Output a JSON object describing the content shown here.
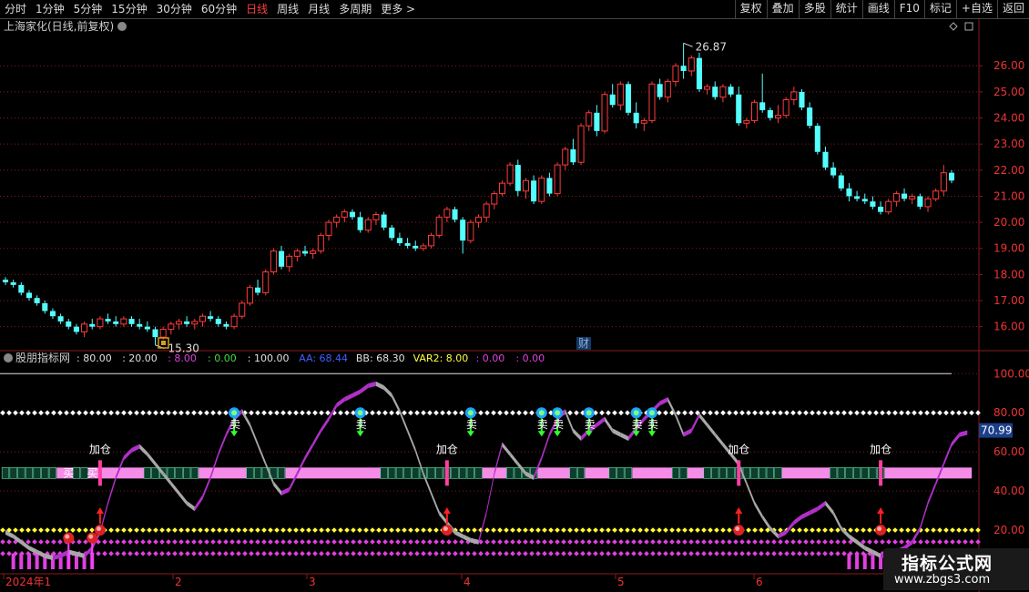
{
  "toolbar": {
    "left": [
      {
        "label": "分时",
        "active": false
      },
      {
        "label": "1分钟",
        "active": false
      },
      {
        "label": "5分钟",
        "active": false
      },
      {
        "label": "15分钟",
        "active": false
      },
      {
        "label": "30分钟",
        "active": false
      },
      {
        "label": "60分钟",
        "active": false
      },
      {
        "label": "日线",
        "active": true
      },
      {
        "label": "周线",
        "active": false
      },
      {
        "label": "月线",
        "active": false
      },
      {
        "label": "多周期",
        "active": false
      },
      {
        "label": "更多 >",
        "active": false
      }
    ],
    "right": [
      "复权",
      "叠加",
      "多股",
      "统计",
      "画线",
      "F10",
      "标记",
      "+自选",
      "返回"
    ]
  },
  "main_panel": {
    "title": "上海家化(日线,前复权)",
    "high_label": "26.87",
    "low_label": "15.30",
    "fin_marker": "财"
  },
  "indicator_panel": {
    "title": "股朋指标网",
    "values": [
      {
        "text": ": 80.00",
        "color": "#e0e0e0"
      },
      {
        "text": ": 20.00",
        "color": "#e0e0e0"
      },
      {
        "text": ": 8.00",
        "color": "#e040e0"
      },
      {
        "text": ": 0.00",
        "color": "#40e040"
      },
      {
        "text": ": 100.00",
        "color": "#e0e0e0"
      },
      {
        "text": "AA: 68.44",
        "color": "#4060ff"
      },
      {
        "text": "BB: 68.30",
        "color": "#e0e0e0"
      },
      {
        "text": "VAR2: 8.00",
        "color": "#ffff40"
      },
      {
        "text": ": 0.00",
        "color": "#e040e0"
      },
      {
        "text": ": 0.00",
        "color": "#e040e0"
      }
    ],
    "current_label": "70.99"
  },
  "signals": {
    "buy_text": "买",
    "sell_text": "卖",
    "add_text": "加仓"
  },
  "watermark": {
    "line1": "指标公式网",
    "line2": "www.zbgs3.com"
  },
  "colors": {
    "up": "#ff3b3b",
    "down": "#54ffff",
    "grid": "#8a1a1a",
    "axis": "#8a1a1a"
  },
  "chart_data": [
    {
      "type": "candlestick",
      "title": "上海家化(日线,前复权)",
      "ylim": [
        15.5,
        27.3
      ],
      "y_ticks": [
        16.0,
        17.0,
        18.0,
        19.0,
        20.0,
        21.0,
        22.0,
        23.0,
        24.0,
        25.0,
        26.0
      ],
      "x_ticks": [
        "2024年1",
        "2",
        "3",
        "4",
        "5",
        "6"
      ],
      "ohlc": [
        [
          17.8,
          17.9,
          17.6,
          17.7
        ],
        [
          17.7,
          17.8,
          17.5,
          17.6
        ],
        [
          17.6,
          17.7,
          17.2,
          17.3
        ],
        [
          17.3,
          17.4,
          17.0,
          17.1
        ],
        [
          17.1,
          17.2,
          16.8,
          16.9
        ],
        [
          16.9,
          17.0,
          16.5,
          16.6
        ],
        [
          16.6,
          16.7,
          16.3,
          16.4
        ],
        [
          16.4,
          16.5,
          16.1,
          16.2
        ],
        [
          16.2,
          16.3,
          15.9,
          16.0
        ],
        [
          16.0,
          16.1,
          15.7,
          15.8
        ],
        [
          15.8,
          16.2,
          15.6,
          16.1
        ],
        [
          16.1,
          16.3,
          15.9,
          16.0
        ],
        [
          16.0,
          16.4,
          15.9,
          16.3
        ],
        [
          16.3,
          16.5,
          16.1,
          16.2
        ],
        [
          16.2,
          16.4,
          16.0,
          16.1
        ],
        [
          16.1,
          16.4,
          16.0,
          16.3
        ],
        [
          16.3,
          16.4,
          16.0,
          16.1
        ],
        [
          16.1,
          16.3,
          15.9,
          16.0
        ],
        [
          16.0,
          16.2,
          15.8,
          15.9
        ],
        [
          15.9,
          16.0,
          15.3,
          15.6
        ],
        [
          15.6,
          16.0,
          15.5,
          15.9
        ],
        [
          15.9,
          16.2,
          15.7,
          16.1
        ],
        [
          16.1,
          16.3,
          15.9,
          16.2
        ],
        [
          16.2,
          16.4,
          16.0,
          16.1
        ],
        [
          16.1,
          16.3,
          15.9,
          16.2
        ],
        [
          16.2,
          16.5,
          16.0,
          16.4
        ],
        [
          16.4,
          16.6,
          16.2,
          16.3
        ],
        [
          16.3,
          16.4,
          16.0,
          16.1
        ],
        [
          16.1,
          16.2,
          15.9,
          16.0
        ],
        [
          16.0,
          16.5,
          15.9,
          16.4
        ],
        [
          16.4,
          17.0,
          16.3,
          16.9
        ],
        [
          16.9,
          17.6,
          16.8,
          17.5
        ],
        [
          17.5,
          17.8,
          17.2,
          17.3
        ],
        [
          17.3,
          18.2,
          17.2,
          18.1
        ],
        [
          18.1,
          19.0,
          18.0,
          18.9
        ],
        [
          18.9,
          19.1,
          18.2,
          18.3
        ],
        [
          18.3,
          18.8,
          18.1,
          18.7
        ],
        [
          18.7,
          19.0,
          18.5,
          18.9
        ],
        [
          18.9,
          19.1,
          18.7,
          18.8
        ],
        [
          18.8,
          19.0,
          18.6,
          18.9
        ],
        [
          18.9,
          19.6,
          18.8,
          19.5
        ],
        [
          19.5,
          20.1,
          19.3,
          20.0
        ],
        [
          20.0,
          20.3,
          19.8,
          20.2
        ],
        [
          20.2,
          20.5,
          20.0,
          20.4
        ],
        [
          20.4,
          20.5,
          20.1,
          20.2
        ],
        [
          20.2,
          20.4,
          19.6,
          19.7
        ],
        [
          19.7,
          20.2,
          19.6,
          20.1
        ],
        [
          20.1,
          20.4,
          19.9,
          20.3
        ],
        [
          20.3,
          20.4,
          19.7,
          19.8
        ],
        [
          19.8,
          19.9,
          19.3,
          19.4
        ],
        [
          19.4,
          19.6,
          19.1,
          19.2
        ],
        [
          19.2,
          19.4,
          19.0,
          19.1
        ],
        [
          19.1,
          19.3,
          18.9,
          19.0
        ],
        [
          19.0,
          19.2,
          18.9,
          19.1
        ],
        [
          19.1,
          19.6,
          19.0,
          19.5
        ],
        [
          19.5,
          20.3,
          19.4,
          20.2
        ],
        [
          20.2,
          20.6,
          20.0,
          20.5
        ],
        [
          20.5,
          20.6,
          20.0,
          20.1
        ],
        [
          20.1,
          20.2,
          18.8,
          19.3
        ],
        [
          19.3,
          20.1,
          19.2,
          20.0
        ],
        [
          20.0,
          20.3,
          19.8,
          20.2
        ],
        [
          20.2,
          20.8,
          20.0,
          20.7
        ],
        [
          20.7,
          21.2,
          20.5,
          21.1
        ],
        [
          21.1,
          21.6,
          21.0,
          21.5
        ],
        [
          21.5,
          22.3,
          21.4,
          22.2
        ],
        [
          22.2,
          22.4,
          21.0,
          21.2
        ],
        [
          21.2,
          21.7,
          20.9,
          21.6
        ],
        [
          21.6,
          21.8,
          20.7,
          20.8
        ],
        [
          20.8,
          21.8,
          20.7,
          21.7
        ],
        [
          21.7,
          21.9,
          21.0,
          21.1
        ],
        [
          21.1,
          22.3,
          21.0,
          22.2
        ],
        [
          22.2,
          22.9,
          22.0,
          22.8
        ],
        [
          22.8,
          23.2,
          22.2,
          22.3
        ],
        [
          22.3,
          23.8,
          22.2,
          23.7
        ],
        [
          23.7,
          24.3,
          23.5,
          24.2
        ],
        [
          24.2,
          24.5,
          23.3,
          23.5
        ],
        [
          23.5,
          25.0,
          23.4,
          24.9
        ],
        [
          24.9,
          25.3,
          24.4,
          24.5
        ],
        [
          24.5,
          25.4,
          24.3,
          25.3
        ],
        [
          25.3,
          25.4,
          24.1,
          24.2
        ],
        [
          24.2,
          24.6,
          23.6,
          23.8
        ],
        [
          23.8,
          24.0,
          23.5,
          23.9
        ],
        [
          23.9,
          25.4,
          23.8,
          25.3
        ],
        [
          25.3,
          25.5,
          24.7,
          24.8
        ],
        [
          24.8,
          25.5,
          24.6,
          25.4
        ],
        [
          25.4,
          26.1,
          25.2,
          26.0
        ],
        [
          26.0,
          26.87,
          25.5,
          25.8
        ],
        [
          25.8,
          26.4,
          25.6,
          26.3
        ],
        [
          26.3,
          26.5,
          25.0,
          25.1
        ],
        [
          25.1,
          25.3,
          24.9,
          25.2
        ],
        [
          25.2,
          25.4,
          24.7,
          24.8
        ],
        [
          24.8,
          25.3,
          24.6,
          25.2
        ],
        [
          25.2,
          25.3,
          24.8,
          24.9
        ],
        [
          24.9,
          25.2,
          23.7,
          23.8
        ],
        [
          23.8,
          24.0,
          23.6,
          23.9
        ],
        [
          23.9,
          24.7,
          23.8,
          24.6
        ],
        [
          24.6,
          25.7,
          24.2,
          24.3
        ],
        [
          24.3,
          24.4,
          23.9,
          24.0
        ],
        [
          24.0,
          24.5,
          23.8,
          24.1
        ],
        [
          24.1,
          24.8,
          24.0,
          24.7
        ],
        [
          24.7,
          25.2,
          24.5,
          25.0
        ],
        [
          25.0,
          25.1,
          24.3,
          24.4
        ],
        [
          24.4,
          24.6,
          23.6,
          23.7
        ],
        [
          23.7,
          23.8,
          22.6,
          22.7
        ],
        [
          22.7,
          22.9,
          22.0,
          22.1
        ],
        [
          22.1,
          22.3,
          21.7,
          21.8
        ],
        [
          21.8,
          21.9,
          21.2,
          21.3
        ],
        [
          21.3,
          21.5,
          20.8,
          21.0
        ],
        [
          21.0,
          21.2,
          20.8,
          20.9
        ],
        [
          20.9,
          21.1,
          20.7,
          20.8
        ],
        [
          20.8,
          21.0,
          20.5,
          20.6
        ],
        [
          20.6,
          20.8,
          20.3,
          20.4
        ],
        [
          20.4,
          20.9,
          20.3,
          20.8
        ],
        [
          20.8,
          21.2,
          20.6,
          21.1
        ],
        [
          21.1,
          21.3,
          20.8,
          20.9
        ],
        [
          20.9,
          21.1,
          20.7,
          21.0
        ],
        [
          21.0,
          21.1,
          20.5,
          20.6
        ],
        [
          20.6,
          21.0,
          20.4,
          20.9
        ],
        [
          20.9,
          21.3,
          20.8,
          21.2
        ],
        [
          21.2,
          22.2,
          21.0,
          21.9
        ],
        [
          21.9,
          22.0,
          21.5,
          21.6
        ]
      ]
    },
    {
      "type": "line",
      "title": "股朋指标网",
      "ylim": [
        0,
        102
      ],
      "y_ticks": [
        20.0,
        40.0,
        60.0,
        80.0,
        100.0
      ],
      "levels": {
        "upper": 80,
        "lower": 20,
        "low_line": 8,
        "top_line": 100
      },
      "current": 70.99,
      "series": [
        {
          "values": [
            20,
            18,
            15,
            12,
            10,
            8,
            7,
            8,
            10,
            9,
            8,
            12,
            20,
            35,
            48,
            58,
            62,
            64,
            60,
            55,
            50,
            45,
            40,
            35,
            32,
            38,
            48,
            60,
            70,
            78,
            82,
            75,
            65,
            55,
            45,
            40,
            42,
            50,
            58,
            65,
            72,
            78,
            85,
            88,
            90,
            92,
            95,
            96,
            94,
            90,
            82,
            72,
            62,
            50,
            40,
            30,
            25,
            20,
            18,
            16,
            15,
            30,
            50,
            65,
            60,
            55,
            50,
            48,
            58,
            70,
            78,
            82,
            72,
            68,
            72,
            75,
            78,
            72,
            70,
            68,
            73,
            78,
            82,
            86,
            88,
            80,
            70,
            72,
            80,
            75,
            70,
            65,
            60,
            55,
            45,
            35,
            28,
            22,
            18,
            20,
            25,
            28,
            30,
            32,
            35,
            30,
            22,
            18,
            15,
            12,
            10,
            8,
            8,
            10,
            12,
            15,
            22,
            35,
            45,
            55,
            65,
            70,
            71
          ]
        }
      ],
      "signals": [
        {
          "type": "buy",
          "bar": 8
        },
        {
          "type": "buy",
          "bar": 11
        },
        {
          "type": "sell",
          "bar": 29
        },
        {
          "type": "sell",
          "bar": 45
        },
        {
          "type": "sell",
          "bar": 59
        },
        {
          "type": "sell",
          "bar": 68
        },
        {
          "type": "sell",
          "bar": 70
        },
        {
          "type": "sell",
          "bar": 74
        },
        {
          "type": "sell",
          "bar": 80
        },
        {
          "type": "sell",
          "bar": 82
        },
        {
          "type": "add",
          "bar": 12
        },
        {
          "type": "add",
          "bar": 56
        },
        {
          "type": "add",
          "bar": 93
        },
        {
          "type": "add",
          "bar": 111
        }
      ]
    }
  ]
}
